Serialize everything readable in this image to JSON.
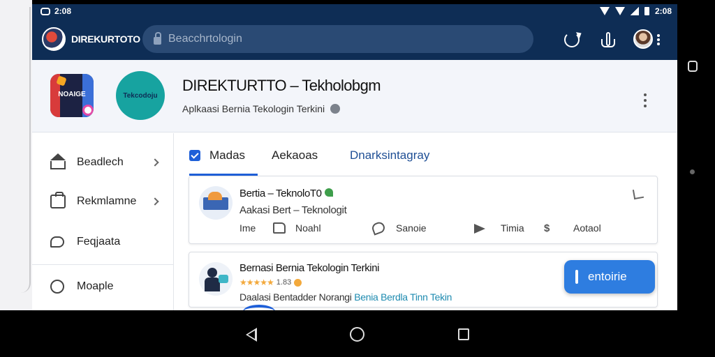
{
  "status_bar": {
    "left_text": "2:08",
    "right_text": "2:08"
  },
  "app_bar": {
    "brand": "DIREKURTOTO",
    "search_placeholder": "Beacchrtologin"
  },
  "header": {
    "app_icon_text": "NOAIGE",
    "logo_text": "Tekcodoju",
    "title": "DIREKTURTTO – Tekholobgm",
    "subtitle": "Aplkaasi Bernia Tekologin Terkini"
  },
  "sidebar": {
    "items": [
      {
        "label": "Beadlech",
        "icon": "home-icon"
      },
      {
        "label": "Rekmlamne",
        "icon": "bag-icon"
      },
      {
        "label": "Feqjaata",
        "icon": "chat-icon"
      },
      {
        "label": "Moaple",
        "icon": "dots-icon"
      }
    ]
  },
  "tabs": [
    {
      "label": "Madas",
      "active": true
    },
    {
      "label": "Aekaoas",
      "active": false
    },
    {
      "label": "Dnarksintagray",
      "active": false
    }
  ],
  "cards": [
    {
      "title": "Bertia – TeknoloT0",
      "subtitle": "Aakasi Bert – Teknologit",
      "actions": [
        "Ime",
        "Noahl",
        "Sanoie",
        "Timia",
        "Aotaol"
      ]
    },
    {
      "title": "Bernasi Bernia Tekologin Terkini",
      "rating_text": "1.83",
      "desc_plain": "Daalasi Bentadder Norangi",
      "desc_link": "Benia Berdla Tinn Tekin"
    }
  ],
  "fab": {
    "label": "entoirie"
  },
  "colors": {
    "app_bar": "#0e2d55",
    "accent": "#1e5fd8",
    "teal": "#17a3a0",
    "fab": "#2e7de0"
  }
}
